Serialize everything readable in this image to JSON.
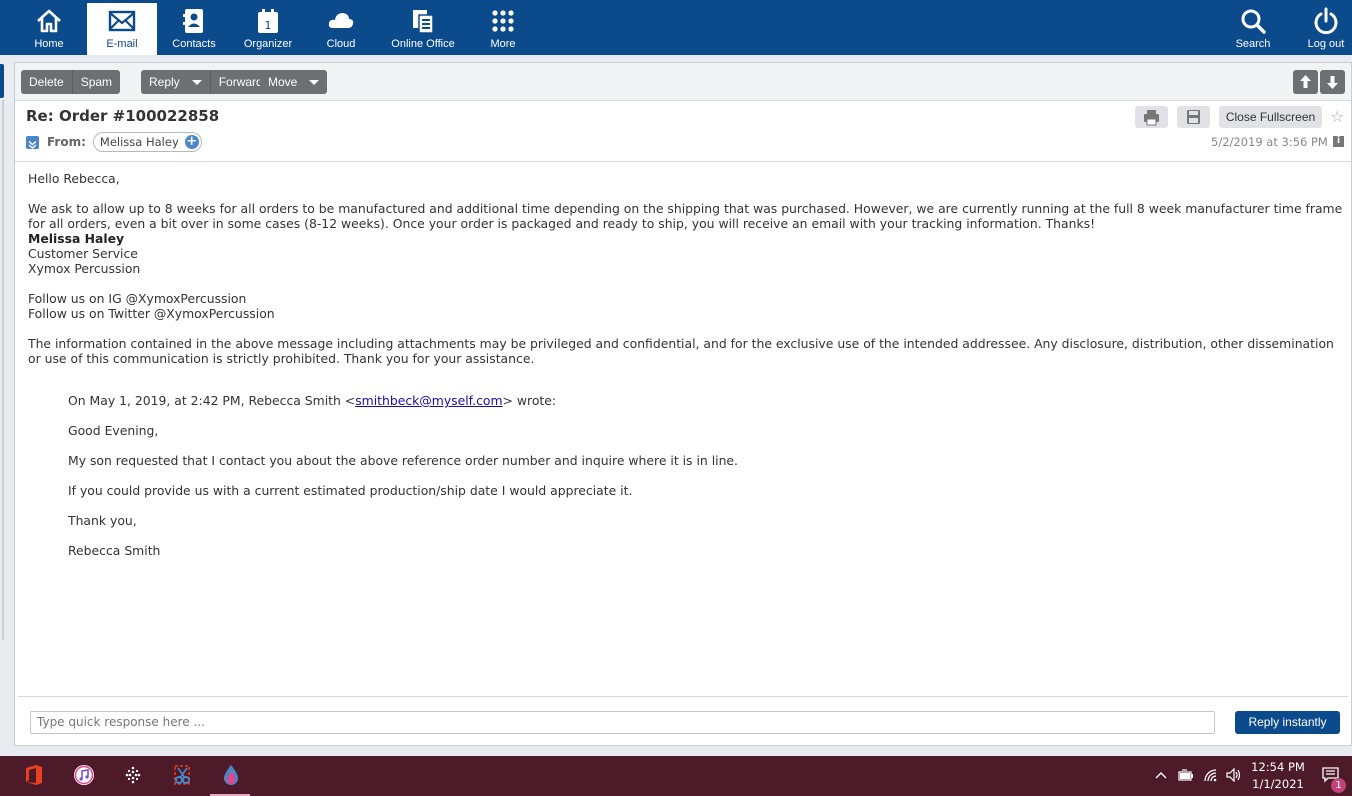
{
  "nav": {
    "items": [
      {
        "label": "Home",
        "icon": "home-icon"
      },
      {
        "label": "E-mail",
        "icon": "mail-icon"
      },
      {
        "label": "Contacts",
        "icon": "contacts-icon"
      },
      {
        "label": "Organizer",
        "icon": "calendar-icon",
        "badge": "1"
      },
      {
        "label": "Cloud",
        "icon": "cloud-icon"
      },
      {
        "label": "Online Office",
        "icon": "office-icon"
      },
      {
        "label": "More",
        "icon": "grid-icon"
      }
    ],
    "search_label": "Search",
    "logout_label": "Log out"
  },
  "toolbar": {
    "delete": "Delete",
    "spam": "Spam",
    "reply": "Reply",
    "forward": "Forward",
    "move": "Move"
  },
  "message": {
    "subject": "Re: Order #100022858",
    "from_label": "From:",
    "from_name": "Melissa Haley",
    "close_fullscreen": "Close Fullscreen",
    "datetime": "5/2/2019 at 3:56 PM",
    "greeting": "Hello Rebecca,",
    "para1": "We ask to allow up to 8 weeks for all orders to be manufactured and additional time depending on the shipping that was purchased. However, we are currently running at the full 8 week manufacturer time frame for all orders, even a bit over in some cases (8-12 weeks). Once your order is packaged and ready to ship, you will receive an email with your tracking information. Thanks!",
    "sig_name": "Melissa Haley",
    "sig_title": "Customer Service",
    "sig_company": "Xymox Percussion",
    "follow_ig": "Follow us on IG @XymoxPercussion",
    "follow_tw": "Follow us on Twitter @XymoxPercussion",
    "disclaimer": "The information contained in the above message including attachments may be privileged and confidential, and for the exclusive use of the intended addressee. Any disclosure, distribution, other dissemination or use of this communication is strictly prohibited. Thank you for your assistance.",
    "quote_intro_before": "On May 1, 2019, at 2:42 PM, Rebecca Smith <",
    "quote_email": "smithbeck@myself.com",
    "quote_intro_after": "> wrote:",
    "quote_greeting": "Good Evening,",
    "quote_p1": "My son requested that I contact you about the above reference order number and inquire where it is in line.",
    "quote_p2": "If you could provide us with a current estimated production/ship date I would appreciate it.",
    "quote_thanks": "Thank you,",
    "quote_name": "Rebecca Smith"
  },
  "quick_reply": {
    "placeholder": "Type quick response here ...",
    "button": "Reply instantly"
  },
  "taskbar": {
    "time": "12:54 PM",
    "date": "1/1/2021",
    "notification_count": "1"
  },
  "colors": {
    "brand": "#0b4a8b",
    "toolbar_button": "#6d6f72",
    "taskbar": "#4d1a2a"
  }
}
